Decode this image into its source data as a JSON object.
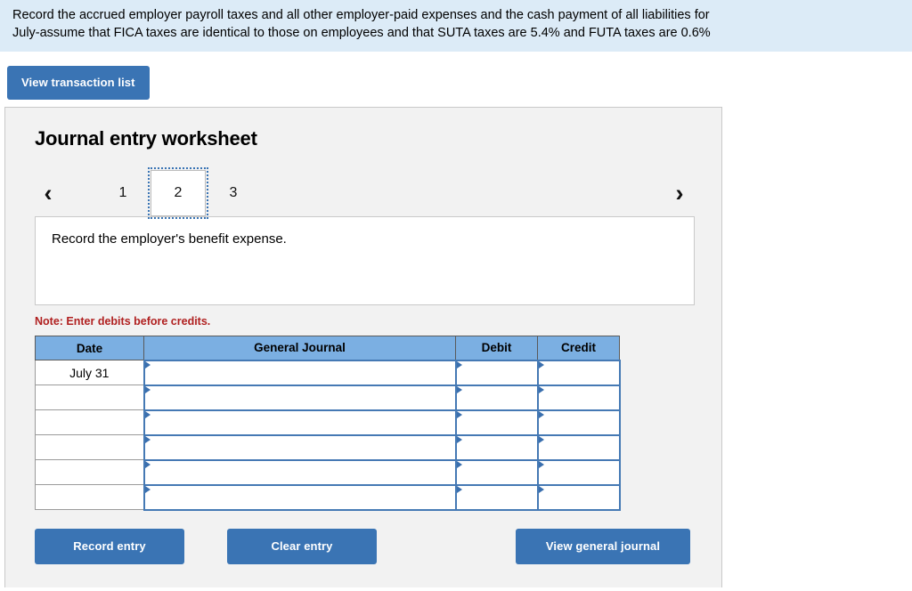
{
  "banner": {
    "line1": "Record the accrued employer payroll taxes and all other employer-paid expenses and the cash payment of all liabilities for",
    "line2": "July-assume that FICA taxes are identical to those on employees and that SUTA taxes are 5.4% and FUTA taxes are 0.6%"
  },
  "toolbar": {
    "view_transaction_list": "View transaction list"
  },
  "panel": {
    "title": "Journal entry worksheet",
    "pager": {
      "prev_icon": "‹",
      "next_icon": "›",
      "pages": [
        "1",
        "2",
        "3"
      ],
      "active_index": 1
    },
    "description": "Record the employer's benefit expense.",
    "note": "Note: Enter debits before credits."
  },
  "table": {
    "headers": [
      "Date",
      "General Journal",
      "Debit",
      "Credit"
    ],
    "rows": [
      {
        "date": "July 31",
        "general_journal": "",
        "debit": "",
        "credit": ""
      },
      {
        "date": "",
        "general_journal": "",
        "debit": "",
        "credit": ""
      },
      {
        "date": "",
        "general_journal": "",
        "debit": "",
        "credit": ""
      },
      {
        "date": "",
        "general_journal": "",
        "debit": "",
        "credit": ""
      },
      {
        "date": "",
        "general_journal": "",
        "debit": "",
        "credit": ""
      },
      {
        "date": "",
        "general_journal": "",
        "debit": "",
        "credit": ""
      }
    ]
  },
  "footer": {
    "record_entry": "Record entry",
    "clear_entry": "Clear entry",
    "view_general_journal": "View general journal"
  },
  "colors": {
    "banner_bg": "#dcebf7",
    "button_blue": "#3a74b4",
    "table_header_blue": "#7bafe2",
    "input_border_blue": "#4579b4",
    "note_red": "#b02020",
    "panel_bg": "#f2f2f2"
  }
}
